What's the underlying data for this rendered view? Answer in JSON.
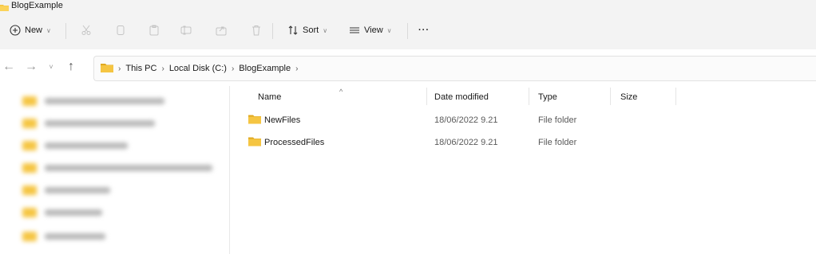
{
  "window": {
    "title": "BlogExample"
  },
  "toolbar": {
    "new_label": "New",
    "sort_label": "Sort",
    "view_label": "View",
    "more_label": "···"
  },
  "nav": {
    "back": "←",
    "forward": "→",
    "recent": "˅",
    "up": "↑"
  },
  "breadcrumb": {
    "separator": "›",
    "items": [
      "This PC",
      "Local Disk (C:)",
      "BlogExample"
    ]
  },
  "list": {
    "columns": {
      "name": "Name",
      "date": "Date modified",
      "type": "Type",
      "size": "Size"
    },
    "sort_indicator": "^",
    "rows": [
      {
        "name": "NewFiles",
        "date": "18/06/2022 9.21",
        "type": "File folder",
        "size": ""
      },
      {
        "name": "ProcessedFiles",
        "date": "18/06/2022 9.21",
        "type": "File folder",
        "size": ""
      }
    ]
  },
  "colors": {
    "folder": "#f5c542",
    "folder_dark": "#e0a920",
    "accent": "#0067c0"
  }
}
